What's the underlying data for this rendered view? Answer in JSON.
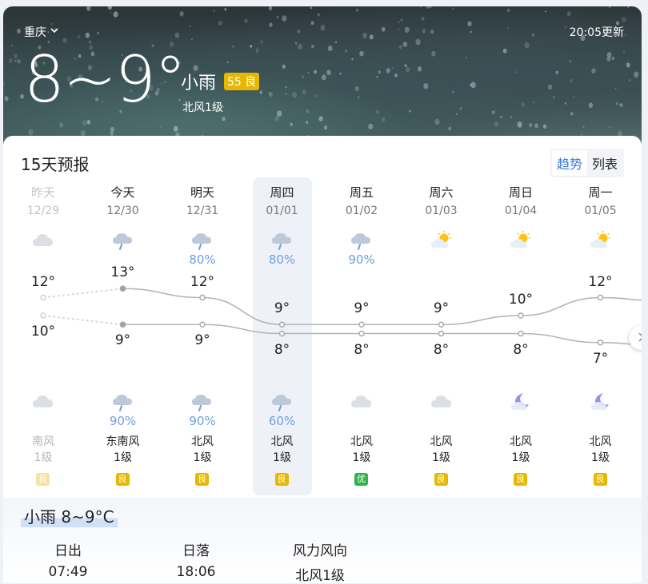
{
  "header": {
    "city": "重庆",
    "update_time": "20:05更新",
    "temp_range": "8~9°",
    "condition": "小雨",
    "aqi": "55 良",
    "wind": "北风1级"
  },
  "forecast": {
    "title": "15天预报",
    "toggle": [
      "趋势",
      "列表"
    ],
    "days": [
      {
        "weekday": "昨天",
        "date": "12/29",
        "day_icon": "cloud-icon",
        "day_pct": "",
        "high": "12°",
        "low": "10°",
        "night_icon": "cloud-icon",
        "night_pct": "",
        "wind_dir": "南风",
        "wind_level": "1级",
        "aqi": "良",
        "aqi_color": "#f5e3a0"
      },
      {
        "weekday": "今天",
        "date": "12/30",
        "day_icon": "rain-cloud-icon",
        "day_pct": "",
        "high": "13°",
        "low": "9°",
        "night_icon": "rain-cloud-icon",
        "night_pct": "90%",
        "wind_dir": "东南风",
        "wind_level": "1级",
        "aqi": "良",
        "aqi_color": "#e6b800"
      },
      {
        "weekday": "明天",
        "date": "12/31",
        "day_icon": "rain-cloud-icon",
        "day_pct": "80%",
        "high": "12°",
        "low": "9°",
        "night_icon": "rain-cloud-icon",
        "night_pct": "90%",
        "wind_dir": "北风",
        "wind_level": "1级",
        "aqi": "良",
        "aqi_color": "#e6b800"
      },
      {
        "weekday": "周四",
        "date": "01/01",
        "day_icon": "rain-cloud-icon",
        "day_pct": "80%",
        "high": "9°",
        "low": "8°",
        "night_icon": "rain-cloud-icon",
        "night_pct": "60%",
        "wind_dir": "北风",
        "wind_level": "1级",
        "aqi": "良",
        "aqi_color": "#e6b800"
      },
      {
        "weekday": "周五",
        "date": "01/02",
        "day_icon": "rain-cloud-icon",
        "day_pct": "90%",
        "high": "9°",
        "low": "8°",
        "night_icon": "cloud-icon",
        "night_pct": "",
        "wind_dir": "北风",
        "wind_level": "1级",
        "aqi": "优",
        "aqi_color": "#2fb44b"
      },
      {
        "weekday": "周六",
        "date": "01/03",
        "day_icon": "sun-cloud-icon",
        "day_pct": "",
        "high": "9°",
        "low": "8°",
        "night_icon": "cloud-icon",
        "night_pct": "",
        "wind_dir": "北风",
        "wind_level": "1级",
        "aqi": "良",
        "aqi_color": "#e6b800"
      },
      {
        "weekday": "周日",
        "date": "01/04",
        "day_icon": "sun-cloud-icon",
        "day_pct": "",
        "high": "10°",
        "low": "8°",
        "night_icon": "moon-cloud-icon",
        "night_pct": "",
        "wind_dir": "北风",
        "wind_level": "1级",
        "aqi": "良",
        "aqi_color": "#e6b800"
      },
      {
        "weekday": "周一",
        "date": "01/05",
        "day_icon": "sun-cloud-icon",
        "day_pct": "",
        "high": "12°",
        "low": "7°",
        "night_icon": "moon-cloud-icon",
        "night_pct": "",
        "wind_dir": "北风",
        "wind_level": "1级",
        "aqi": "良",
        "aqi_color": "#e6b800"
      }
    ]
  },
  "detail": {
    "title": "小雨 8~9°C",
    "items": [
      {
        "label": "日出",
        "value": "07:49"
      },
      {
        "label": "日落",
        "value": "18:06"
      },
      {
        "label": "风力风向",
        "value": "北风1级"
      }
    ]
  }
}
